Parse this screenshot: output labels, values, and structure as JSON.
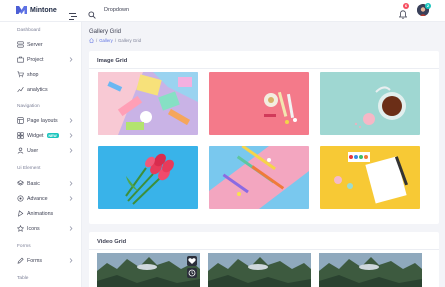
{
  "app": {
    "logo_text": "Mintone"
  },
  "header": {
    "dropdown_label": "Dropdown",
    "notification_count": "6",
    "avatar_badge": "2"
  },
  "sidebar": {
    "sections": [
      {
        "title": "Dashboard",
        "items": [
          {
            "label": "Server",
            "icon": "server-icon",
            "chevron": false
          },
          {
            "label": "Project",
            "icon": "project-icon",
            "chevron": true
          },
          {
            "label": "shop",
            "icon": "shop-icon",
            "chevron": false
          },
          {
            "label": "analytics",
            "icon": "analytics-icon",
            "chevron": false
          }
        ]
      },
      {
        "title": "Navigation",
        "items": [
          {
            "label": "Page layouts",
            "icon": "layout-icon",
            "chevron": true
          },
          {
            "label": "Widget",
            "icon": "widget-icon",
            "chevron": true,
            "badge": "NEW"
          },
          {
            "label": "User",
            "icon": "user-icon",
            "chevron": true
          }
        ]
      },
      {
        "title": "Ui Element",
        "items": [
          {
            "label": "Basic",
            "icon": "basic-icon",
            "chevron": true
          },
          {
            "label": "Advance",
            "icon": "advance-icon",
            "chevron": true
          },
          {
            "label": "Animations",
            "icon": "animation-icon",
            "chevron": false
          },
          {
            "label": "Icons",
            "icon": "icons-icon",
            "chevron": true
          }
        ]
      },
      {
        "title": "Forms",
        "items": [
          {
            "label": "Forms",
            "icon": "forms-icon",
            "chevron": true
          }
        ]
      },
      {
        "title": "Table",
        "items": []
      }
    ]
  },
  "page": {
    "title": "Gallery Grid",
    "breadcrumb": {
      "parent": "Gallery",
      "current": "Gallery Grid"
    }
  },
  "image_grid": {
    "title": "Image Grid"
  },
  "video_grid": {
    "title": "Video Grid"
  },
  "colors": {
    "accent": "#5e72e4",
    "badge_red": "#f64e60",
    "badge_teal": "#1bc5bd"
  }
}
